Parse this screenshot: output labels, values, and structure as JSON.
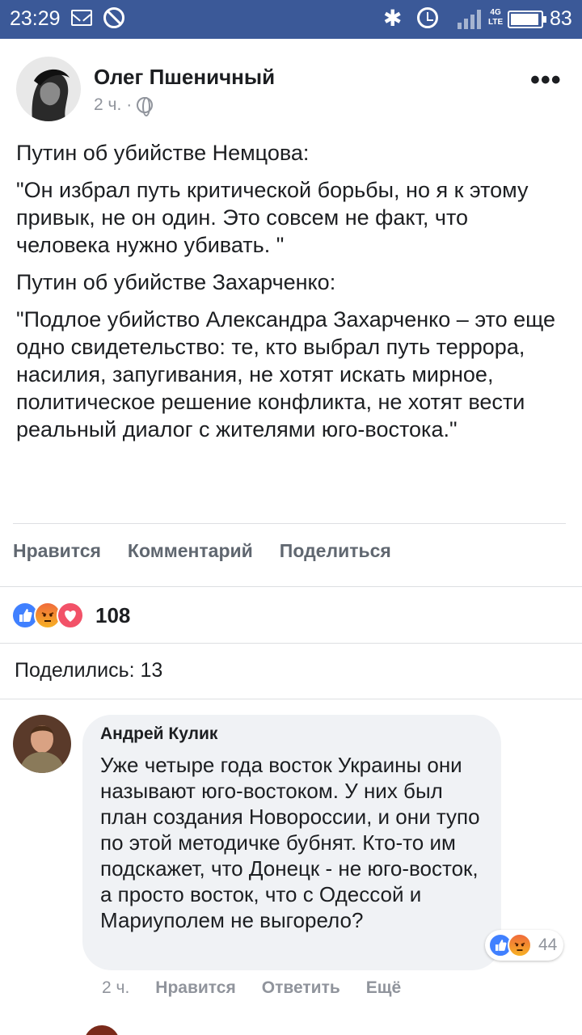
{
  "status_bar": {
    "time": "23:29",
    "battery": "83",
    "network": "4G"
  },
  "post": {
    "author": "Олег Пшеничный",
    "time": "2 ч.",
    "separator": "·",
    "paragraphs": [
      "Путин об убийстве Немцова:",
      "\"Он избрал путь критической борьбы, но я к этому привык, не он один. Это совсем не факт, что человека нужно убивать. \"",
      "Путин об убийстве Захарченко:",
      "\"Подлое убийство Александра Захарченко – это еще одно свидетельство: те, кто выбрал путь террора, насилия, запугивания, не хотят искать мирное, политическое решение конфликта, не хотят вести реальный диалог с жителями юго-востока.\""
    ],
    "actions": {
      "like": "Нравится",
      "comment": "Комментарий",
      "share": "Поделиться"
    },
    "reaction_count": "108",
    "shares": "Поделились: 13"
  },
  "comment": {
    "author": "Андрей Кулик",
    "text": "Уже четыре года восток Украины они называют юго-востоком. У них был план создания Новороссии, и они тупо по этой методичке бубнят. Кто-то им подскажет, что Донецк - не юго-восток, а просто восток, что с Одессой и Мариуполем не выгорело?",
    "reaction_count": "44",
    "time": "2 ч.",
    "like": "Нравится",
    "reply": "Ответить",
    "more": "Ещё"
  },
  "colors": {
    "brand": "#3b5998",
    "like": "#4080ff",
    "love": "#f25268",
    "bubble": "#f0f2f5"
  }
}
